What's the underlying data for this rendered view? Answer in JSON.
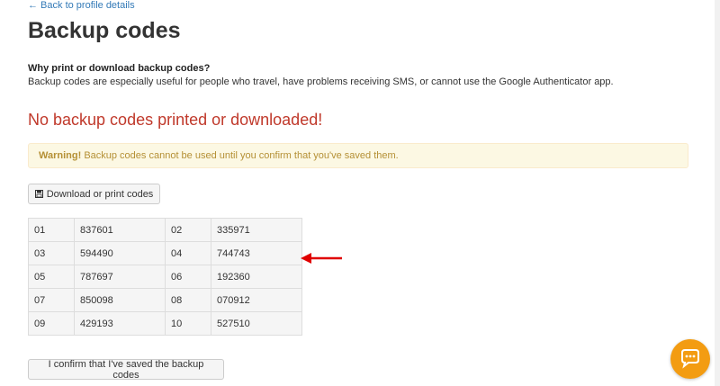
{
  "nav": {
    "back_label": "← Back to profile details"
  },
  "page": {
    "title": "Backup codes"
  },
  "info": {
    "heading": "Why print or download backup codes?",
    "text": "Backup codes are especially useful for people who travel, have problems receiving SMS, or cannot use the Google Authenticator app."
  },
  "status": {
    "message": "No backup codes printed or downloaded!"
  },
  "warning": {
    "label": "Warning!",
    "text": "Backup codes cannot be used until you confirm that you've saved them."
  },
  "buttons": {
    "download_label": "Download or print codes",
    "confirm_label": "I confirm that I've saved the backup codes"
  },
  "codes": [
    [
      {
        "num": "01",
        "code": "837601"
      },
      {
        "num": "02",
        "code": "335971"
      }
    ],
    [
      {
        "num": "03",
        "code": "594490"
      },
      {
        "num": "04",
        "code": "744743"
      }
    ],
    [
      {
        "num": "05",
        "code": "787697"
      },
      {
        "num": "06",
        "code": "192360"
      }
    ],
    [
      {
        "num": "07",
        "code": "850098"
      },
      {
        "num": "08",
        "code": "070912"
      }
    ],
    [
      {
        "num": "09",
        "code": "429193"
      },
      {
        "num": "10",
        "code": "527510"
      }
    ]
  ],
  "icons": {
    "download": "floppy-disk-icon",
    "annotation": "red-arrow-icon",
    "chat": "chat-bubble-icon"
  },
  "colors": {
    "link": "#337ab7",
    "danger": "#c0392b",
    "warning_bg": "#fcf8e3",
    "warning_text": "#b59035",
    "chat_accent": "#f39c12",
    "arrow": "#e00000"
  }
}
